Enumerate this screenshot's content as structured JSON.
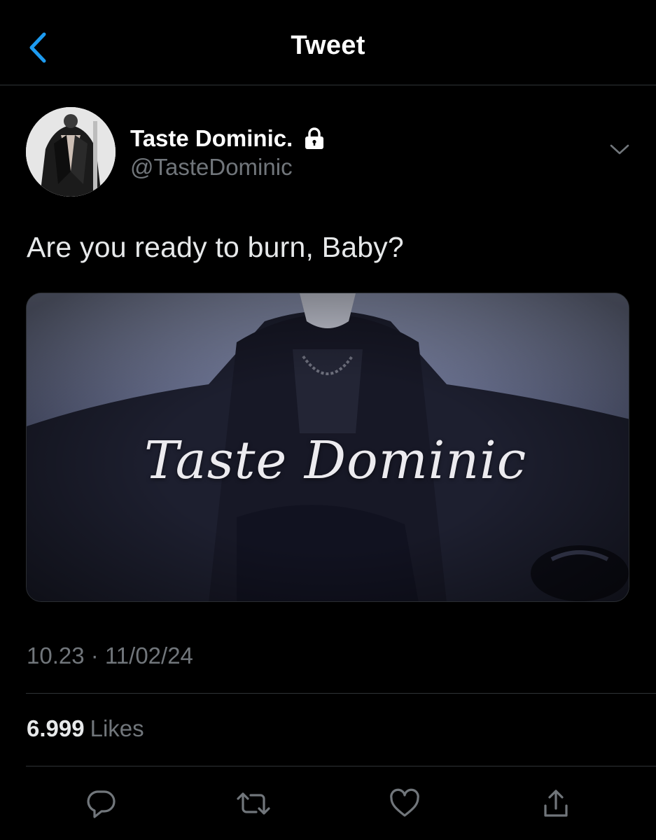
{
  "header": {
    "title": "Tweet",
    "back_icon": "chevron-left-icon"
  },
  "tweet": {
    "author": {
      "display_name": "Taste Dominic.",
      "handle": "@TasteDominic",
      "protected_icon": "lock-icon",
      "avatar": "avatar-photo"
    },
    "more_icon": "chevron-down-icon",
    "text": "Are you ready to burn, Baby?",
    "media": {
      "caption": "Taste Dominic"
    },
    "timestamp": "10.23 · 11/02/24",
    "likes": {
      "count": "6.999",
      "label": "Likes"
    }
  },
  "actions": [
    {
      "name": "reply",
      "icon": "reply-icon"
    },
    {
      "name": "retweet",
      "icon": "retweet-icon"
    },
    {
      "name": "like",
      "icon": "heart-icon"
    },
    {
      "name": "share",
      "icon": "share-icon"
    }
  ],
  "colors": {
    "background": "#000000",
    "accent": "#1d9bf0",
    "secondary_text": "#71767b",
    "divider": "#2f3336"
  }
}
